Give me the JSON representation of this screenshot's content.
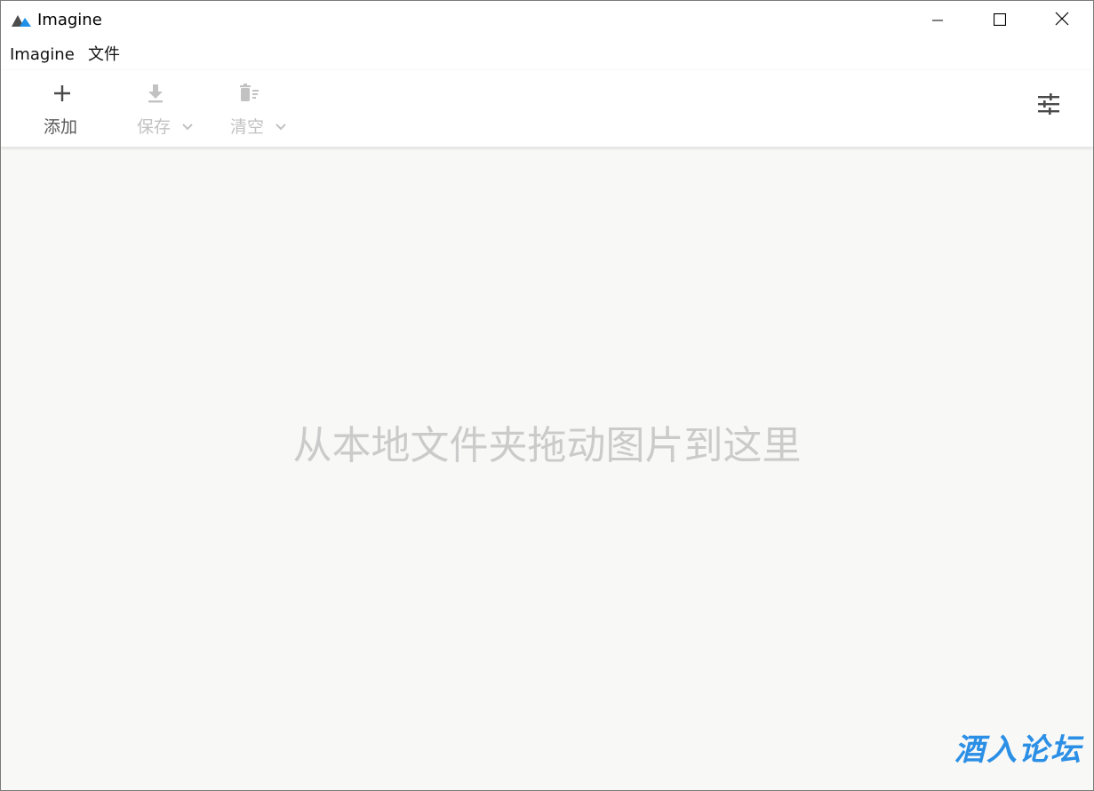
{
  "window": {
    "title": "Imagine",
    "controls": {
      "minimize_icon": "minimize-icon",
      "maximize_icon": "maximize-icon",
      "close_icon": "close-icon"
    }
  },
  "menu": {
    "items": [
      {
        "label": "Imagine"
      },
      {
        "label": "文件"
      }
    ]
  },
  "toolbar": {
    "add": {
      "label": "添加",
      "icon": "plus-icon",
      "enabled": true
    },
    "save": {
      "label": "保存",
      "icon": "download-icon",
      "enabled": false
    },
    "clear": {
      "label": "清空",
      "icon": "trash-icon",
      "enabled": false
    },
    "settings": {
      "icon": "sliders-icon"
    }
  },
  "main": {
    "drop_hint": "从本地文件夹拖动图片到这里"
  },
  "watermark": {
    "text": "酒入论坛"
  },
  "colors": {
    "app_icon_dark": "#4d4d4d",
    "app_icon_accent": "#1e90e8",
    "toolbar_enabled": "#5a5a5a",
    "toolbar_disabled": "#c2c2c2",
    "content_bg": "#f8f8f7",
    "watermark": "#2b8fe6"
  }
}
